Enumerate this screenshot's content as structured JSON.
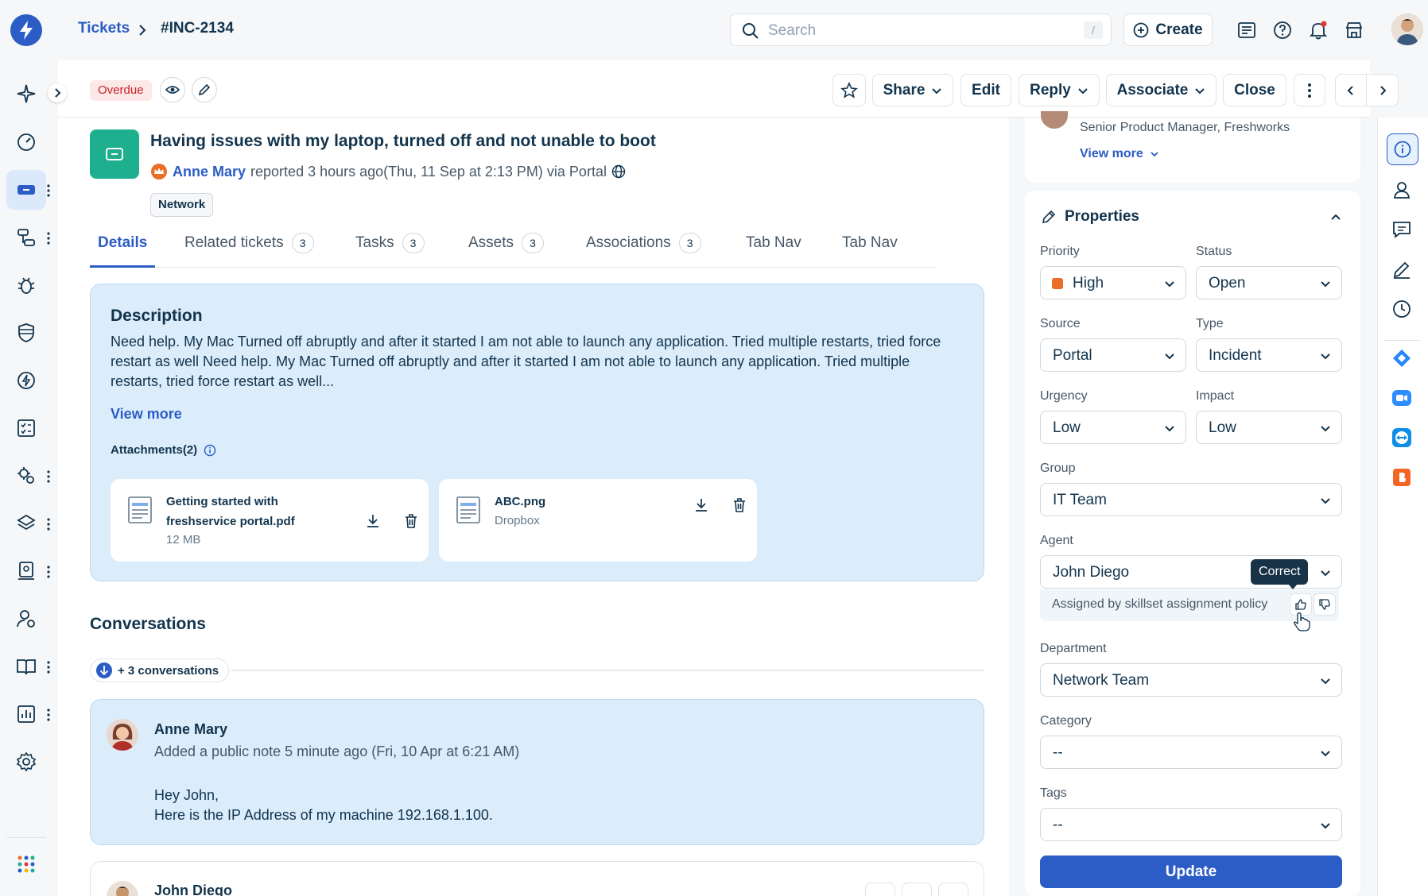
{
  "header": {
    "breadcrumb_root": "Tickets",
    "breadcrumb_current": "#INC-2134",
    "search_placeholder": "Search",
    "search_shortcut": "/",
    "create_label": "Create"
  },
  "action_bar": {
    "status_badge": "Overdue",
    "share_label": "Share",
    "edit_label": "Edit",
    "reply_label": "Reply",
    "associate_label": "Associate",
    "close_label": "Close"
  },
  "ticket": {
    "title": "Having issues with my laptop, turned off and not unable to boot",
    "requester": "Anne Mary",
    "reported_text": "reported 3 hours ago(Thu, 11 Sep at 2:13 PM) via Portal",
    "tag": "Network"
  },
  "tabs": [
    {
      "label": "Details",
      "count": ""
    },
    {
      "label": "Related tickets",
      "count": "3"
    },
    {
      "label": "Tasks",
      "count": "3"
    },
    {
      "label": "Assets",
      "count": "3"
    },
    {
      "label": "Associations",
      "count": "3"
    },
    {
      "label": "Tab Nav",
      "count": ""
    },
    {
      "label": "Tab Nav",
      "count": ""
    }
  ],
  "description": {
    "title": "Description",
    "body": "Need help. My Mac Turned off abruptly and after it started I am not able to launch any application. Tried multiple restarts, tried force restart as well Need help. My Mac Turned off abruptly and after it started I am not able to launch any application. Tried multiple restarts, tried force restart as well...",
    "view_more": "View more",
    "attachments_label": "Attachments(2)",
    "attachments": [
      {
        "name_line1": "Getting started with",
        "name_line2": "freshservice portal.pdf",
        "sub": "12 MB"
      },
      {
        "name_line1": "ABC.png",
        "name_line2": "",
        "sub": "Dropbox"
      }
    ]
  },
  "conversations": {
    "title": "Conversations",
    "more_label": "+ 3 conversations",
    "note": {
      "author": "Anne Mary",
      "meta": "Added a public note 5 minute ago (Fri, 10 Apr at 6:21 AM)",
      "line1": "Hey John,",
      "line2": "Here is the IP Address of my machine 192.168.1.100."
    },
    "next_author": "John Diego"
  },
  "contact": {
    "role": "Senior Product Manager, Freshworks",
    "view_more": "View more"
  },
  "properties": {
    "title": "Properties",
    "priority_label": "Priority",
    "priority_value": "High",
    "priority_color": "#e86f25",
    "status_label": "Status",
    "status_value": "Open",
    "source_label": "Source",
    "source_value": "Portal",
    "type_label": "Type",
    "type_value": "Incident",
    "urgency_label": "Urgency",
    "urgency_value": "Low",
    "impact_label": "Impact",
    "impact_value": "Low",
    "group_label": "Group",
    "group_value": "IT Team",
    "agent_label": "Agent",
    "agent_value": "John Diego",
    "agent_hint": "Assigned by skillset assignment policy",
    "tooltip": "Correct",
    "department_label": "Department",
    "department_value": "Network Team",
    "category_label": "Category",
    "category_value": "--",
    "tags_label": "Tags",
    "tags_value": "--",
    "update_label": "Update"
  },
  "colors": {
    "brand": "#2c5cc5",
    "ticket_icon": "#1eaf8e",
    "overdue": "#c82124"
  }
}
